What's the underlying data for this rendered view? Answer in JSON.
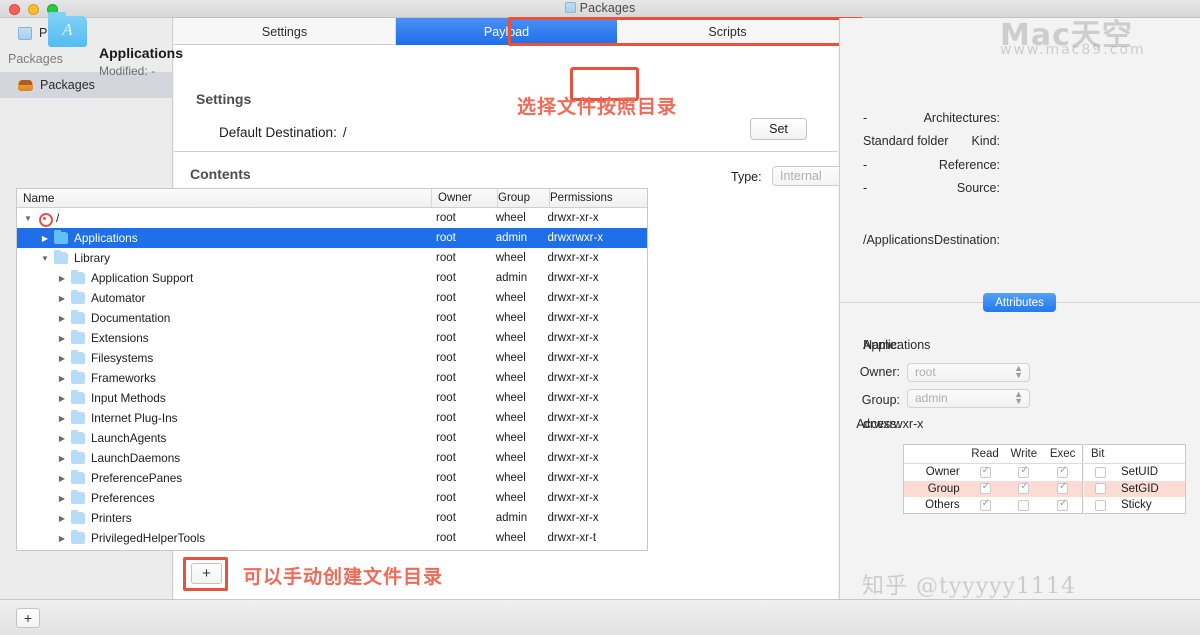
{
  "window": {
    "title": "Packages",
    "traffic_lights": [
      "close",
      "minimize",
      "zoom"
    ]
  },
  "sidebar": {
    "project_label": "Project",
    "section_header": "Packages",
    "package_item": "Packages"
  },
  "tabs": [
    {
      "label": "Settings",
      "active": false
    },
    {
      "label": "Payload",
      "active": true
    },
    {
      "label": "Scripts",
      "active": false
    }
  ],
  "settings": {
    "title": "Settings",
    "default_destination_label": "Default Destination:",
    "default_destination_value": "/",
    "set_button": "Set"
  },
  "contents": {
    "title": "Contents",
    "type_label": "Type:",
    "type_value": "Internal",
    "columns": [
      "Name",
      "Owner",
      "Group",
      "Permissions"
    ],
    "rows": [
      {
        "name": "/",
        "owner": "root",
        "group": "wheel",
        "perm": "drwxr-xr-x",
        "depth": 0,
        "twisty": "open",
        "icon": "disk-icon",
        "selected": false
      },
      {
        "name": "Applications",
        "owner": "root",
        "group": "admin",
        "perm": "drwxrwxr-x",
        "depth": 1,
        "twisty": "closed",
        "icon": "folder-icon",
        "selected": true
      },
      {
        "name": "Library",
        "owner": "root",
        "group": "wheel",
        "perm": "drwxr-xr-x",
        "depth": 1,
        "twisty": "open",
        "icon": "folder-icon",
        "selected": false
      },
      {
        "name": "Application Support",
        "owner": "root",
        "group": "admin",
        "perm": "drwxr-xr-x",
        "depth": 2,
        "twisty": "closed",
        "icon": "folder-icon",
        "selected": false
      },
      {
        "name": "Automator",
        "owner": "root",
        "group": "wheel",
        "perm": "drwxr-xr-x",
        "depth": 2,
        "twisty": "closed",
        "icon": "folder-icon",
        "selected": false
      },
      {
        "name": "Documentation",
        "owner": "root",
        "group": "wheel",
        "perm": "drwxr-xr-x",
        "depth": 2,
        "twisty": "closed",
        "icon": "folder-icon",
        "selected": false
      },
      {
        "name": "Extensions",
        "owner": "root",
        "group": "wheel",
        "perm": "drwxr-xr-x",
        "depth": 2,
        "twisty": "closed",
        "icon": "folder-icon",
        "selected": false
      },
      {
        "name": "Filesystems",
        "owner": "root",
        "group": "wheel",
        "perm": "drwxr-xr-x",
        "depth": 2,
        "twisty": "closed",
        "icon": "folder-icon",
        "selected": false
      },
      {
        "name": "Frameworks",
        "owner": "root",
        "group": "wheel",
        "perm": "drwxr-xr-x",
        "depth": 2,
        "twisty": "closed",
        "icon": "folder-icon",
        "selected": false
      },
      {
        "name": "Input Methods",
        "owner": "root",
        "group": "wheel",
        "perm": "drwxr-xr-x",
        "depth": 2,
        "twisty": "closed",
        "icon": "folder-icon",
        "selected": false
      },
      {
        "name": "Internet Plug-Ins",
        "owner": "root",
        "group": "wheel",
        "perm": "drwxr-xr-x",
        "depth": 2,
        "twisty": "closed",
        "icon": "folder-icon",
        "selected": false
      },
      {
        "name": "LaunchAgents",
        "owner": "root",
        "group": "wheel",
        "perm": "drwxr-xr-x",
        "depth": 2,
        "twisty": "closed",
        "icon": "folder-icon",
        "selected": false
      },
      {
        "name": "LaunchDaemons",
        "owner": "root",
        "group": "wheel",
        "perm": "drwxr-xr-x",
        "depth": 2,
        "twisty": "closed",
        "icon": "folder-icon",
        "selected": false
      },
      {
        "name": "PreferencePanes",
        "owner": "root",
        "group": "wheel",
        "perm": "drwxr-xr-x",
        "depth": 2,
        "twisty": "closed",
        "icon": "folder-icon",
        "selected": false
      },
      {
        "name": "Preferences",
        "owner": "root",
        "group": "wheel",
        "perm": "drwxr-xr-x",
        "depth": 2,
        "twisty": "closed",
        "icon": "folder-icon",
        "selected": false
      },
      {
        "name": "Printers",
        "owner": "root",
        "group": "admin",
        "perm": "drwxr-xr-x",
        "depth": 2,
        "twisty": "closed",
        "icon": "folder-icon",
        "selected": false
      },
      {
        "name": "PrivilegedHelperTools",
        "owner": "root",
        "group": "wheel",
        "perm": "drwxr-xr-t",
        "depth": 2,
        "twisty": "closed",
        "icon": "folder-icon",
        "selected": false
      }
    ],
    "add_button": "+"
  },
  "inspector": {
    "item_name": "Applications",
    "modified_label": "Modified:",
    "modified_value": "-",
    "fields": [
      {
        "key": "Architectures:",
        "value": "-"
      },
      {
        "key": "Kind:",
        "value": "Standard folder"
      },
      {
        "key": "Reference:",
        "value": "-"
      },
      {
        "key": "Source:",
        "value": "-"
      },
      {
        "key": "Destination:",
        "value": "/Applications"
      }
    ],
    "attributes_tab": "Attributes",
    "name_label": "Name:",
    "name_value": "Applications",
    "owner_label": "Owner:",
    "owner_value": "root",
    "group_label": "Group:",
    "group_value": "admin",
    "access_label": "Access:",
    "access_value": "drwxrwxr-x",
    "permissions": {
      "columns": [
        "Read",
        "Write",
        "Exec"
      ],
      "bit_column": "Bit",
      "rows": [
        {
          "label": "Owner",
          "read": true,
          "write": true,
          "exec": true,
          "bit_checked": false,
          "bit_label": "SetUID",
          "highlight": false
        },
        {
          "label": "Group",
          "read": true,
          "write": true,
          "exec": true,
          "bit_checked": false,
          "bit_label": "SetGID",
          "highlight": true
        },
        {
          "label": "Others",
          "read": true,
          "write": false,
          "exec": true,
          "bit_checked": false,
          "bit_label": "Sticky",
          "highlight": false
        }
      ]
    }
  },
  "bottom": {
    "add_button": "+"
  },
  "annotations": [
    {
      "text": "选择文件按照目录",
      "color": "#ef6a57"
    },
    {
      "text": "可以手动创建文件目录",
      "color": "#ef6a57"
    }
  ],
  "watermarks": {
    "top_main": "Mac天空",
    "top_sub": "www.mac89.com",
    "bottom": "知乎 @tyyyyy1114"
  }
}
